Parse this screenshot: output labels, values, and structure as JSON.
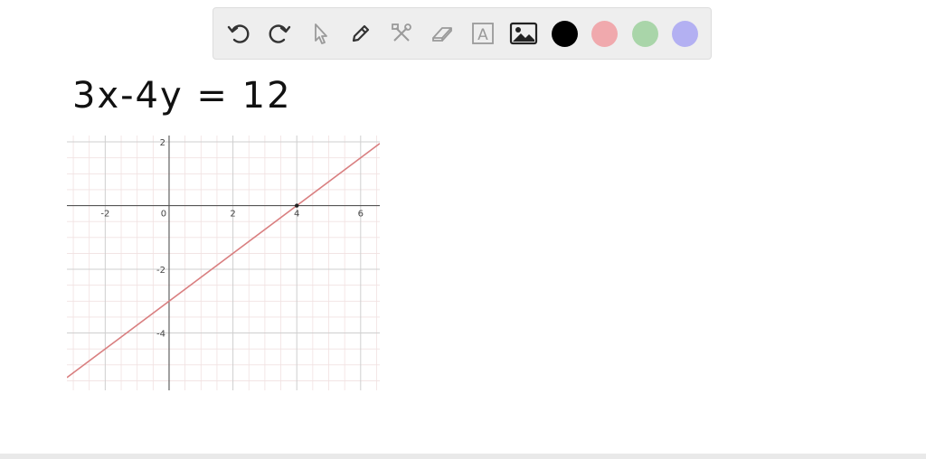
{
  "toolbar": {
    "tools": [
      {
        "name": "undo-icon"
      },
      {
        "name": "redo-icon"
      },
      {
        "name": "select-pointer-icon"
      },
      {
        "name": "pen-icon"
      },
      {
        "name": "tools-icon"
      },
      {
        "name": "eraser-icon"
      },
      {
        "name": "text-box-icon",
        "glyph": "A"
      },
      {
        "name": "image-icon"
      }
    ],
    "colors": [
      {
        "name": "color-black",
        "hex": "#000000"
      },
      {
        "name": "color-red",
        "hex": "#f0a9ad"
      },
      {
        "name": "color-green",
        "hex": "#a9d5a9"
      },
      {
        "name": "color-purple",
        "hex": "#b3b0f2"
      }
    ]
  },
  "canvas": {
    "equation": "3x-4y = 12"
  },
  "chart_data": {
    "type": "line",
    "title": "",
    "xlabel": "",
    "ylabel": "",
    "xlim": [
      -3.2,
      6.6
    ],
    "ylim": [
      -5.8,
      2.2
    ],
    "grid": true,
    "x_ticks": [
      -2,
      0,
      2,
      4,
      6
    ],
    "y_ticks": [
      2,
      -2,
      -4
    ],
    "x_tick_labels": [
      "-2",
      "0",
      "2",
      "4",
      "6"
    ],
    "y_tick_labels": [
      "2",
      "-2",
      "-4"
    ],
    "line": {
      "x": [
        -3.2,
        6.6
      ],
      "y": [
        -5.4,
        1.95
      ],
      "color": "#d97f80"
    },
    "points": [
      {
        "x": 4,
        "y": 0
      }
    ]
  }
}
